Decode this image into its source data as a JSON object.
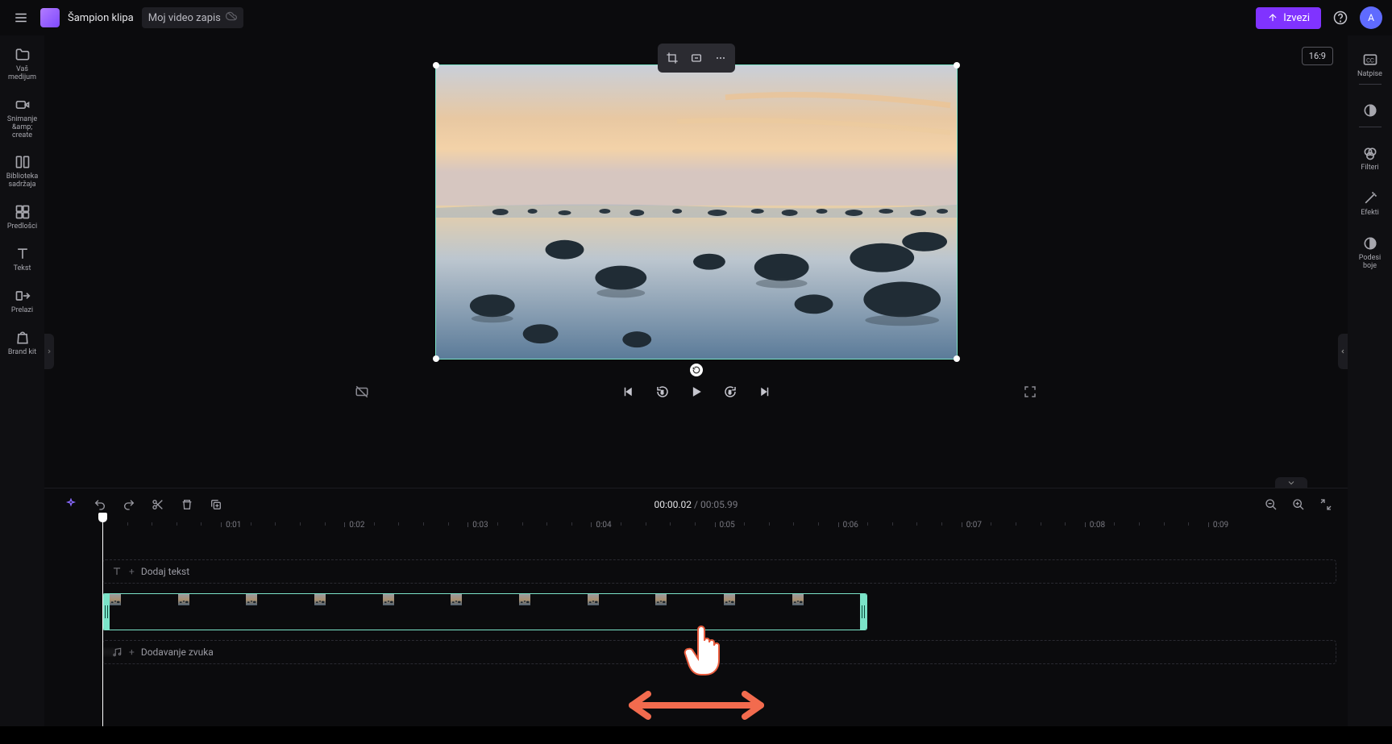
{
  "topbar": {
    "app_name": "Šampion klipa",
    "project_name": "Moj video zapis",
    "export_label": "Izvezi",
    "avatar_initial": "A"
  },
  "left_sidebar": {
    "items": [
      {
        "label": "Vaš medijum"
      },
      {
        "label": "Snimanje &amp;\ncreate"
      },
      {
        "label": "Biblioteka\nsadržaja"
      },
      {
        "label": "Predlošci"
      },
      {
        "label": "Tekst"
      },
      {
        "label": "Prelazi"
      },
      {
        "label": "Brand kit"
      }
    ]
  },
  "right_sidebar": {
    "items": [
      {
        "label": "Natpise"
      },
      {
        "label": ""
      },
      {
        "label": "Filteri"
      },
      {
        "label": "Efekti"
      },
      {
        "label": "Podesi\nboje"
      }
    ]
  },
  "stage": {
    "aspect_label": "16:9"
  },
  "timeline": {
    "current_time": "00:00.02",
    "duration": "00:05.99",
    "ruler_marks": [
      "0:01",
      "0:02",
      "0:03",
      "0:04",
      "0:05",
      "0:06",
      "0:07",
      "0:08",
      "0:09"
    ],
    "text_track_label": "Dodaj tekst",
    "audio_track_label": "Dodavanje zvuka"
  }
}
